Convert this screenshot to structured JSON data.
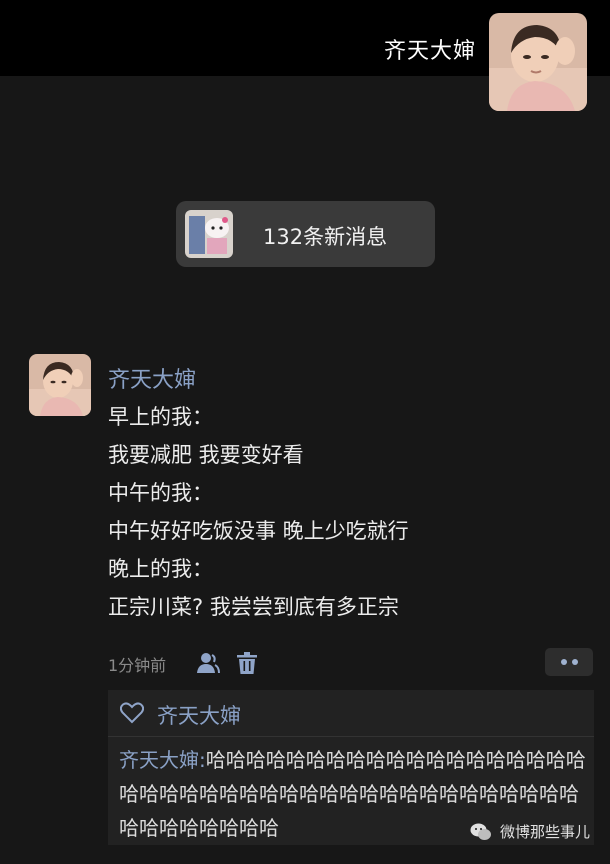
{
  "header": {
    "name": "齐天大婶"
  },
  "banner": {
    "label": "132条新消息"
  },
  "message": {
    "author": "齐天大婶",
    "lines": [
      "早上的我：",
      "我要减肥 我要变好看",
      "中午的我：",
      "中午好好吃饭没事 晚上少吃就行",
      "晚上的我：",
      "正宗川菜? 我尝尝到底有多正宗"
    ],
    "time": "1分钟前"
  },
  "likes": {
    "name": "齐天大婶"
  },
  "comment": {
    "author": "齐天大婶:",
    "text": "哈哈哈哈哈哈哈哈哈哈哈哈哈哈哈哈哈哈哈哈哈哈哈哈哈哈哈哈哈哈哈哈哈哈哈哈哈哈哈哈哈哈哈哈哈哈哈哈哈哈"
  },
  "watermark": {
    "text": "微博那些事儿"
  },
  "icons": {
    "user": "user-icon",
    "trash": "trash-icon",
    "heart": "heart-icon",
    "more": "more-icon",
    "wechat": "wechat-icon"
  },
  "colors": {
    "link_blue": "#8aa1c6",
    "background": "#171717",
    "topbar": "#000000"
  }
}
